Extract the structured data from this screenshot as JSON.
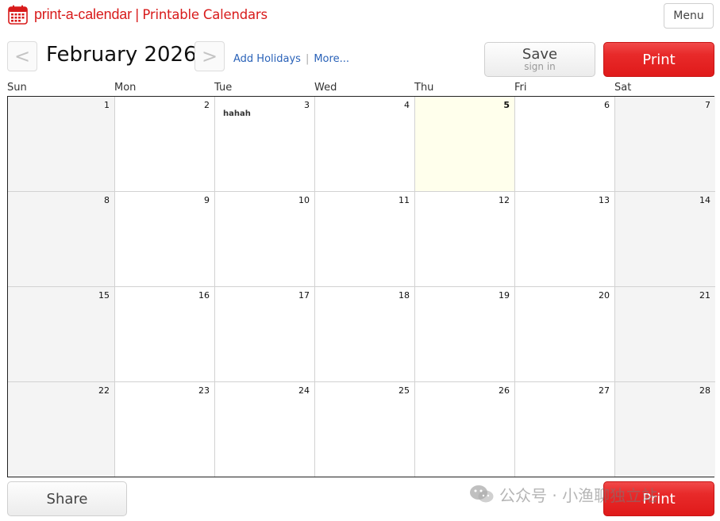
{
  "header": {
    "logo_brand": "print-a-calendar",
    "logo_separator": "|",
    "logo_tagline": "Printable Calendars",
    "menu_label": "Menu"
  },
  "nav": {
    "prev_label": "<",
    "next_label": ">",
    "month_title": "February 2026",
    "add_holidays": "Add Holidays",
    "links_separator": "|",
    "more": "More..."
  },
  "actions": {
    "save_label": "Save",
    "save_sub": "sign in",
    "print_label": "Print",
    "share_label": "Share"
  },
  "calendar": {
    "weekdays": [
      "Sun",
      "Mon",
      "Tue",
      "Wed",
      "Thu",
      "Fri",
      "Sat"
    ],
    "today": 5,
    "weeks": [
      [
        1,
        2,
        3,
        4,
        5,
        6,
        7
      ],
      [
        8,
        9,
        10,
        11,
        12,
        13,
        14
      ],
      [
        15,
        16,
        17,
        18,
        19,
        20,
        21
      ],
      [
        22,
        23,
        24,
        25,
        26,
        27,
        28
      ]
    ],
    "events": [
      {
        "day": 3,
        "title": "hahah"
      }
    ]
  },
  "watermark": {
    "text": "公众号 · 小渔聊独立站"
  },
  "colors": {
    "brand_red": "#d81b1b",
    "print_red": "#e82a2a",
    "link_blue": "#2a62b8",
    "weekend_bg": "#f4f4f4",
    "today_bg": "#ffffec"
  }
}
